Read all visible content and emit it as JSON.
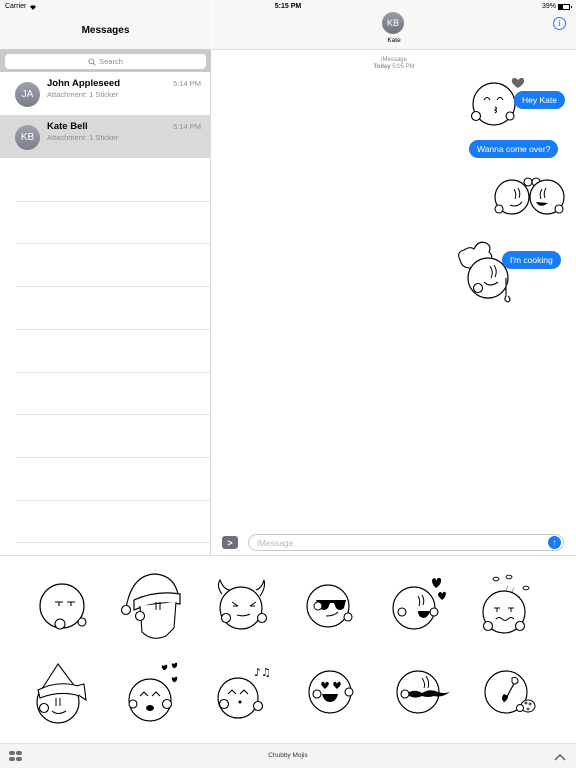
{
  "status_bar": {
    "carrier": "Carrier",
    "wifi_icon": "wifi-icon",
    "time": "5:15 PM",
    "battery_percent_label": "39%",
    "battery_level": 0.39
  },
  "sidebar": {
    "title": "Messages",
    "search_placeholder": "Search",
    "conversations": [
      {
        "initials": "JA",
        "name": "John Appleseed",
        "time": "5:14 PM",
        "preview": "Attachment: 1 Sticker",
        "selected": false
      },
      {
        "initials": "KB",
        "name": "Kate Bell",
        "time": "5:14 PM",
        "preview": "Attachment: 1 Sticker",
        "selected": true
      }
    ]
  },
  "conversation": {
    "contact_initials": "KB",
    "contact_name": "Kate",
    "info_icon": "i",
    "service": "iMessage",
    "date_bold": "Today",
    "date_time": "5:05 PM",
    "messages": [
      {
        "type": "sticker",
        "sticker": "kiss-face-with-heart"
      },
      {
        "type": "text",
        "text": "Hey Kate"
      },
      {
        "type": "text",
        "text": "Wanna come over?"
      },
      {
        "type": "sticker",
        "sticker": "two-faces-hugging"
      },
      {
        "type": "sticker",
        "sticker": "chef-face"
      },
      {
        "type": "text",
        "text": "I'm cooking"
      }
    ],
    "apps_button": ">",
    "input_placeholder": "iMessage",
    "send_icon": "↑"
  },
  "sticker_drawer": {
    "app_name": "Chubby Mojis",
    "stickers": [
      "tongue-out-face",
      "santa-face",
      "devil-face",
      "sunglasses-face",
      "love-hearts-face",
      "stinky-face",
      "elf-face",
      "kiss-hearts-face",
      "whistling-music-face",
      "heart-eyes-face",
      "mustache-face",
      "painter-face"
    ]
  }
}
